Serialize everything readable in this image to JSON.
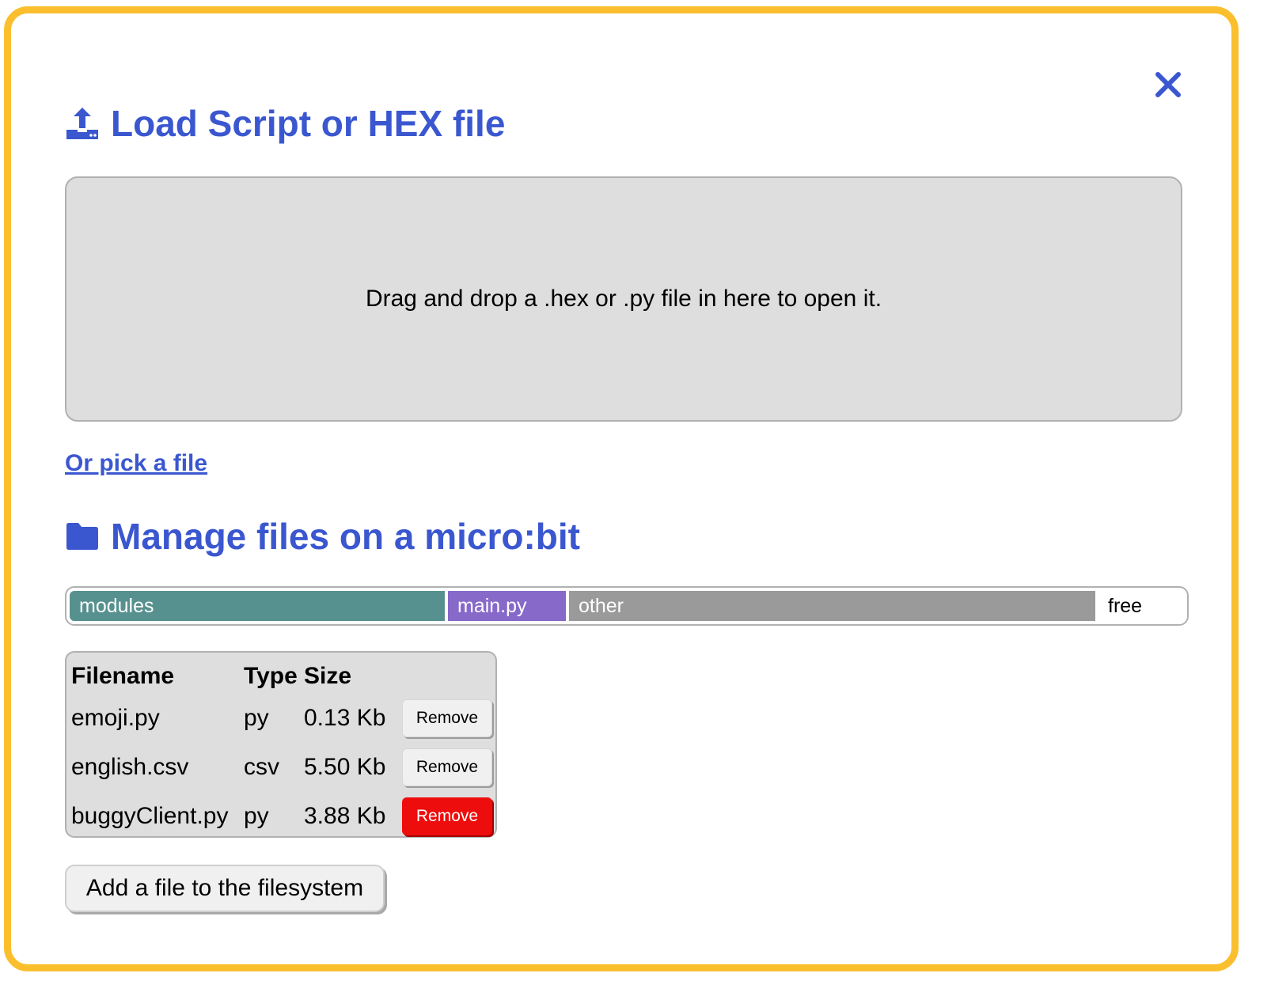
{
  "dialog": {
    "close_icon": "close-icon",
    "load_heading": "Load Script or HEX file",
    "load_icon": "upload-icon",
    "dropzone_text": "Drag and drop a .hex or .py file in here to open it.",
    "pick_link": "Or pick a file",
    "manage_heading": "Manage files on a micro:bit",
    "manage_icon": "folder-icon"
  },
  "usage": {
    "segments": [
      {
        "label": "modules",
        "color": "#57918f"
      },
      {
        "label": "main.py",
        "color": "#8769c9"
      },
      {
        "label": "other",
        "color": "#9a9a9a"
      },
      {
        "label": "free",
        "color": "#ffffff"
      }
    ]
  },
  "files": {
    "headers": {
      "filename": "Filename",
      "type": "Type",
      "size": "Size"
    },
    "rows": [
      {
        "filename": "emoji.py",
        "type": "py",
        "size": "0.13 Kb",
        "action": "Remove"
      },
      {
        "filename": "english.csv",
        "type": "csv",
        "size": "5.50 Kb",
        "action": "Remove"
      },
      {
        "filename": "buggyClient.py",
        "type": "py",
        "size": "3.88 Kb",
        "action": "Remove"
      }
    ],
    "danger_color": "#ee0d0d"
  },
  "add_button": "Add a file to the filesystem",
  "colors": {
    "accent": "#3a57d0",
    "border": "#fbbf2e"
  }
}
